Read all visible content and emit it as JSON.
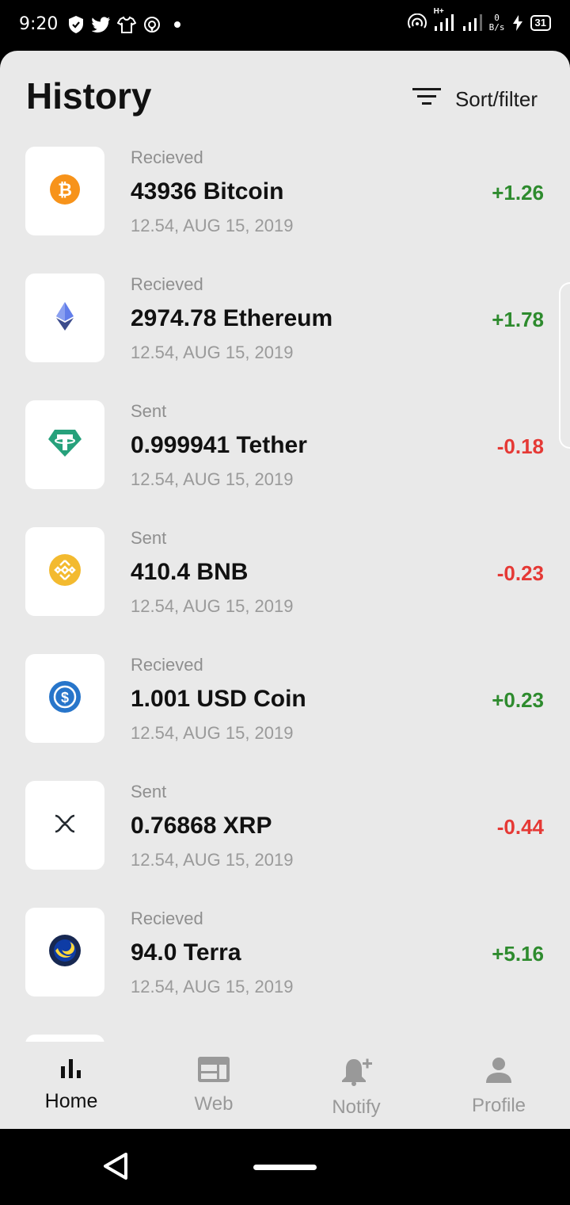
{
  "status_bar": {
    "time": "9:20",
    "network": "H+",
    "speed_top": "0",
    "speed_bottom": "B/s",
    "battery": "31"
  },
  "header": {
    "title": "History",
    "sort_filter_label": "Sort/filter"
  },
  "transactions": [
    {
      "type": "Recieved",
      "title": "43936 Bitcoin",
      "date": "12.54, AUG 15, 2019",
      "amount": "+1.26",
      "coin": "bitcoin-icon",
      "color": "#f7931a"
    },
    {
      "type": "Recieved",
      "title": "2974.78 Ethereum",
      "date": "12.54, AUG 15, 2019",
      "amount": "+1.78",
      "coin": "ethereum-icon",
      "color": "#627eea"
    },
    {
      "type": "Sent",
      "title": "0.999941 Tether",
      "date": "12.54, AUG 15, 2019",
      "amount": "-0.18",
      "coin": "tether-icon",
      "color": "#26a17b"
    },
    {
      "type": "Sent",
      "title": "410.4 BNB",
      "date": "12.54, AUG 15, 2019",
      "amount": "-0.23",
      "coin": "bnb-icon",
      "color": "#f3ba2f"
    },
    {
      "type": "Recieved",
      "title": "1.001 USD Coin",
      "date": "12.54, AUG 15, 2019",
      "amount": "+0.23",
      "coin": "usd-coin-icon",
      "color": "#2775ca"
    },
    {
      "type": "Sent",
      "title": "0.76868 XRP",
      "date": "12.54, AUG 15, 2019",
      "amount": "-0.44",
      "coin": "xrp-icon",
      "color": "#23292f"
    },
    {
      "type": "Recieved",
      "title": "94.0 Terra",
      "date": "12.54, AUG 15, 2019",
      "amount": "+5.16",
      "coin": "terra-icon",
      "color": "#0e3ca5"
    }
  ],
  "colors": {
    "positive": "#2e8b2e",
    "negative": "#e53935"
  },
  "nav": {
    "items": [
      {
        "label": "Home",
        "icon": "bar-chart-icon",
        "active": true
      },
      {
        "label": "Web",
        "icon": "web-icon",
        "active": false
      },
      {
        "label": "Notify",
        "icon": "bell-plus-icon",
        "active": false
      },
      {
        "label": "Profile",
        "icon": "person-icon",
        "active": false
      }
    ]
  }
}
